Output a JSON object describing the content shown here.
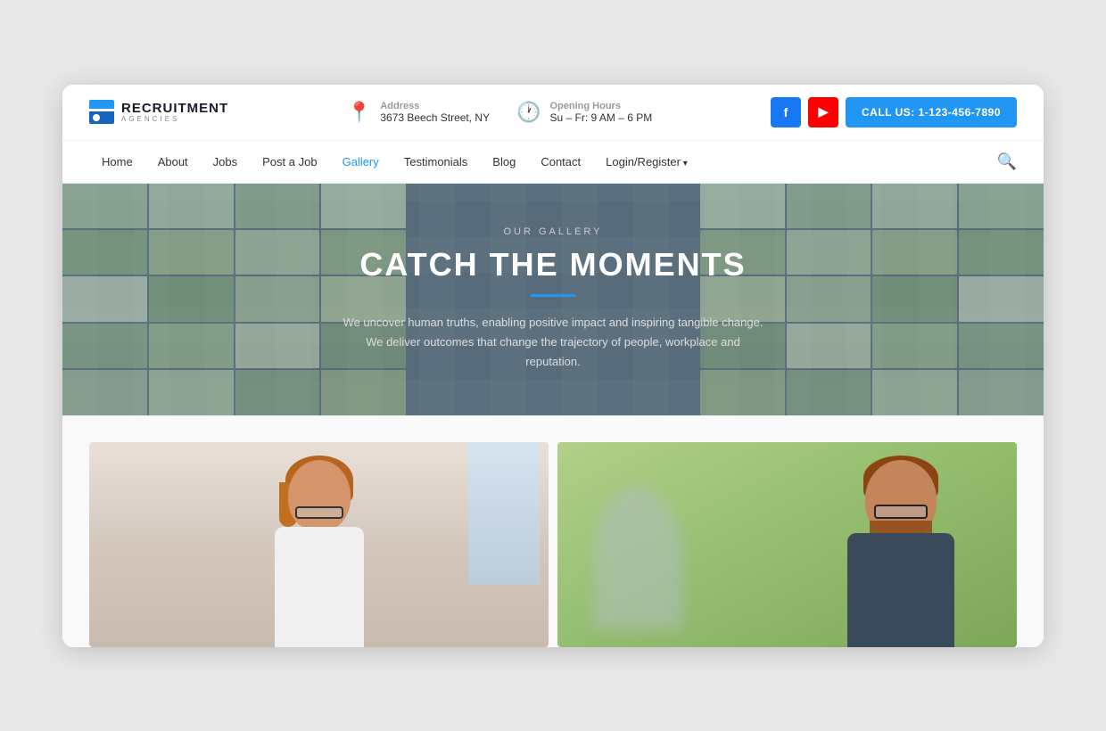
{
  "browser": {
    "background": "#e8e8e8"
  },
  "header": {
    "logo": {
      "main": "RECRUITMENT",
      "sub": "AGENCIES"
    },
    "address": {
      "label": "Address",
      "value": "3673 Beech Street, NY"
    },
    "hours": {
      "label": "Opening Hours",
      "value": "Su – Fr: 9 AM – 6 PM"
    },
    "call_button": "CALL US: 1-123-456-7890",
    "social": {
      "facebook": "f",
      "youtube": "▶"
    }
  },
  "nav": {
    "items": [
      {
        "label": "Home",
        "active": false
      },
      {
        "label": "About",
        "active": false
      },
      {
        "label": "Jobs",
        "active": false
      },
      {
        "label": "Post a Job",
        "active": false
      },
      {
        "label": "Gallery",
        "active": true
      },
      {
        "label": "Testimonials",
        "active": false
      },
      {
        "label": "Blog",
        "active": false
      },
      {
        "label": "Contact",
        "active": false
      },
      {
        "label": "Login/Register",
        "active": false,
        "has_arrow": true
      }
    ]
  },
  "hero": {
    "subtitle": "OUR GALLERY",
    "title": "CATCH THE MOMENTS",
    "description": "We uncover human truths, enabling positive impact and inspiring tangible change. We deliver outcomes that change the trajectory of people, workplace and reputation."
  },
  "gallery": {
    "items": [
      {
        "alt": "Woman with glasses working at desk"
      },
      {
        "alt": "Bearded man with glasses in meeting"
      }
    ]
  }
}
